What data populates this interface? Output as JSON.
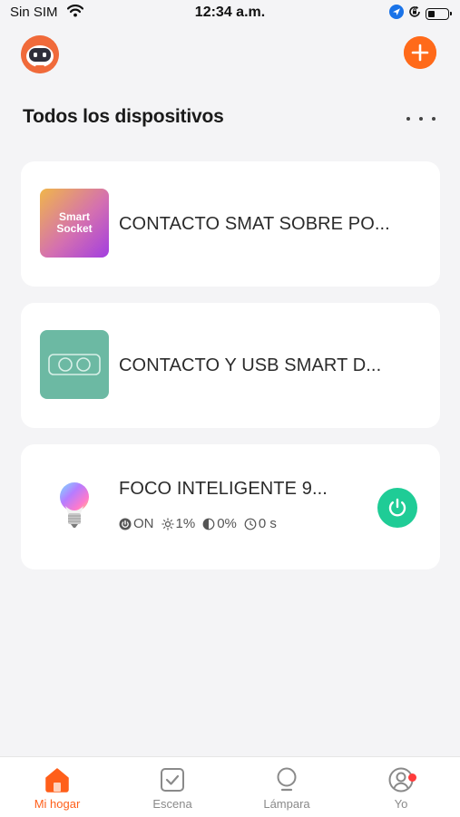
{
  "status_bar": {
    "carrier": "Sin SIM",
    "time": "12:34 a.m.",
    "icons": [
      "wifi-icon",
      "location-arrow-icon",
      "orientation-lock-icon",
      "battery-icon"
    ]
  },
  "header": {
    "avatar_icon": "robot-avatar-icon",
    "add_icon": "plus-icon"
  },
  "home": {
    "title": "Todos los dispositivos",
    "more_icon": "more-dots-icon"
  },
  "devices": [
    {
      "name": "CONTACTO SMAT SOBRE PO...",
      "thumb_line1": "Smart",
      "thumb_line2": "Socket",
      "icon": "smart-socket-icon"
    },
    {
      "name": "CONTACTO Y USB SMART D...",
      "icon": "usb-socket-icon"
    },
    {
      "name": "FOCO INTELIGENTE 9...",
      "icon": "bulb-icon",
      "status": {
        "power": "ON",
        "brightness": "1%",
        "color_temp": "0%",
        "timer": "0 s"
      },
      "power_icon": "power-icon",
      "power_color": "#1fcc96"
    }
  ],
  "tabs": [
    {
      "label": "Mi hogar",
      "icon": "home-icon",
      "active": true
    },
    {
      "label": "Escena",
      "icon": "scene-check-icon",
      "active": false
    },
    {
      "label": "Lámpara",
      "icon": "lamp-icon",
      "active": false
    },
    {
      "label": "Yo",
      "icon": "profile-icon",
      "active": false,
      "badge": true
    }
  ],
  "colors": {
    "accent": "#ff6a1a",
    "active_tab": "#ff5f1a",
    "power_on": "#1fcc96",
    "background": "#f4f4f6"
  }
}
